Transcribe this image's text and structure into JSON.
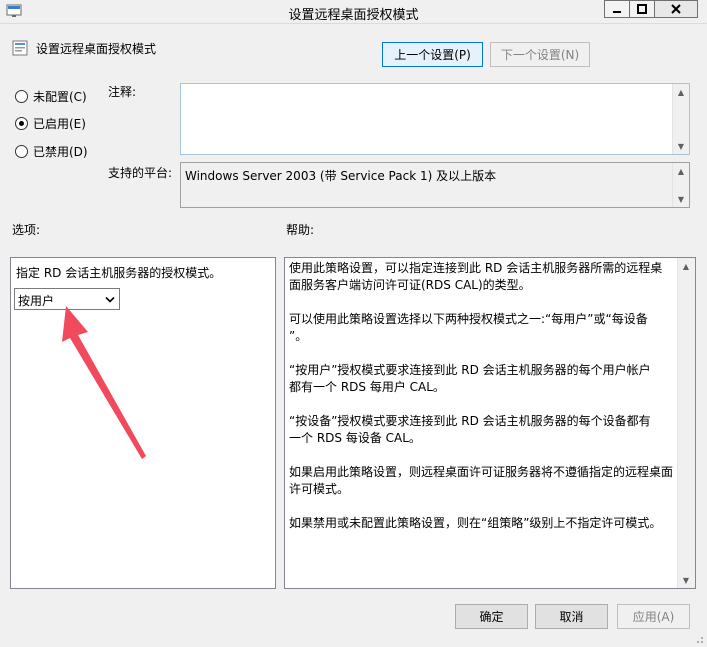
{
  "window": {
    "title": "设置远程桌面授权模式"
  },
  "header": {
    "policy_name": "设置远程桌面授权模式",
    "prev_button": "上一个设置(P)",
    "next_button": "下一个设置(N)"
  },
  "state": {
    "options": [
      {
        "label": "未配置(C)",
        "checked": false
      },
      {
        "label": "已启用(E)",
        "checked": true
      },
      {
        "label": "已禁用(D)",
        "checked": false
      }
    ]
  },
  "comment": {
    "label": "注释:",
    "value": ""
  },
  "platform": {
    "label": "支持的平台:",
    "value": "Windows Server 2003 (带 Service Pack 1) 及以上版本"
  },
  "options_section": {
    "label": "选项:",
    "description": "指定 RD 会话主机服务器的授权模式。",
    "selected": "按用户"
  },
  "help_section": {
    "label": "帮助:",
    "lines": [
      "使用此策略设置，可以指定连接到此 RD 会话主机服务器所需的远程桌",
      "面服务客户端访问许可证(RDS CAL)的类型。",
      "",
      "可以使用此策略设置选择以下两种授权模式之一:“每用户”或“每设备",
      "”。",
      "",
      "“按用户”授权模式要求连接到此 RD 会话主机服务器的每个用户帐户",
      "都有一个 RDS 每用户 CAL。",
      "",
      "“按设备”授权模式要求连接到此 RD 会话主机服务器的每个设备都有",
      "一个 RDS 每设备 CAL。",
      "",
      "如果启用此策略设置，则远程桌面许可证服务器将不遵循指定的远程桌面",
      "许可模式。",
      "",
      "如果禁用或未配置此策略设置，则在“组策略”级别上不指定许可模式。"
    ]
  },
  "footer": {
    "ok": "确定",
    "cancel": "取消",
    "apply": "应用(A)"
  }
}
